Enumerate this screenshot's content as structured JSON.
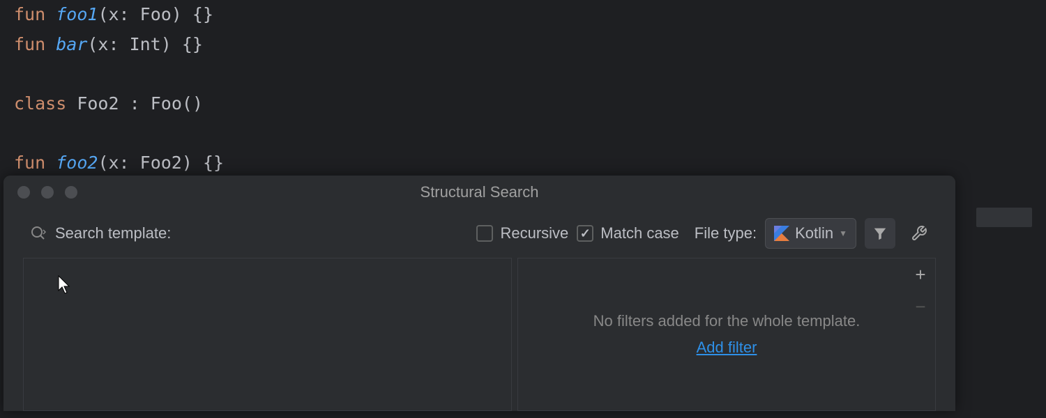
{
  "code": {
    "line1": {
      "kw": "fun",
      "fn": "foo1",
      "params": "(x: Foo)",
      "body": "{}"
    },
    "line2": {
      "kw": "fun",
      "fn": "bar",
      "params": "(x: Int)",
      "body": "{}"
    },
    "line3": "",
    "line4": {
      "kw": "class",
      "name": "Foo2",
      "sep": ":",
      "super": "Foo()"
    },
    "line5": "",
    "line6": {
      "kw": "fun",
      "fn": "foo2",
      "params": "(x: Foo2)",
      "body": "{}"
    }
  },
  "dialog": {
    "title": "Structural Search",
    "search_label": "Search template:",
    "recursive_label": "Recursive",
    "recursive_checked": false,
    "match_case_label": "Match case",
    "match_case_checked": true,
    "file_type_label": "File type:",
    "file_type_value": "Kotlin",
    "filters_text": "No filters added for the whole template.",
    "add_filter_label": "Add filter"
  }
}
